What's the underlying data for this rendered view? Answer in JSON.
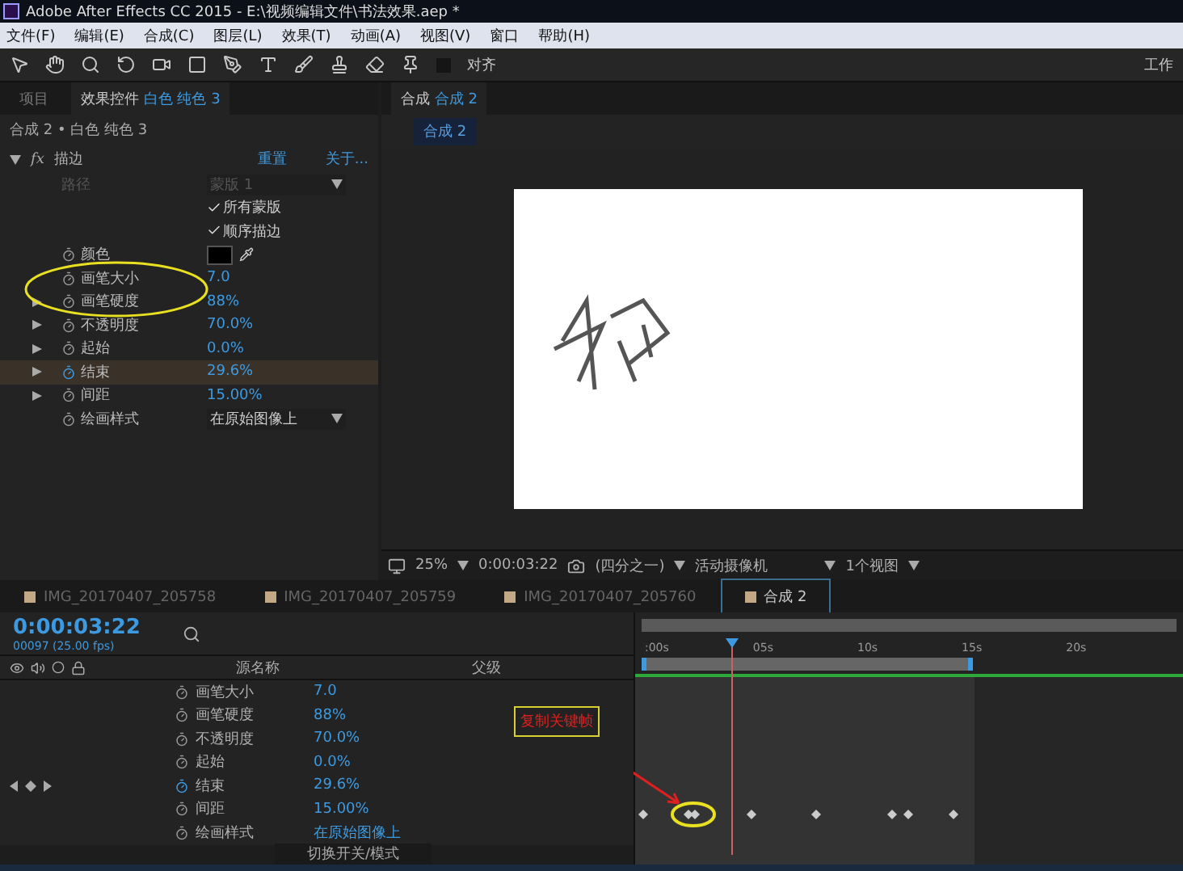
{
  "window": {
    "title": "Adobe After Effects CC 2015 - E:\\视频编辑文件\\书法效果.aep *"
  },
  "menu": [
    "文件(F)",
    "编辑(E)",
    "合成(C)",
    "图层(L)",
    "效果(T)",
    "动画(A)",
    "视图(V)",
    "窗口",
    "帮助(H)"
  ],
  "toolbar": {
    "snap_label": "对齐",
    "snap_checked": false,
    "workspace": "工作"
  },
  "left_panel": {
    "tabs": [
      {
        "label": "项目",
        "selected": false
      },
      {
        "label": "效果控件",
        "subject": "白色 纯色 3",
        "selected": true
      }
    ],
    "breadcrumb": "合成 2 • 白色 纯色 3",
    "effect": {
      "icon_label": "fx",
      "name": "描边",
      "reset": "重置",
      "about": "关于...",
      "props": [
        {
          "kind": "dropdown",
          "label": "路径",
          "value": "蒙版 1",
          "disabled": true
        },
        {
          "kind": "checkbox",
          "label": "所有蒙版",
          "checked": true
        },
        {
          "kind": "checkbox",
          "label": "顺序描边",
          "checked": true
        },
        {
          "kind": "color",
          "label": "颜色",
          "color": "#000000"
        },
        {
          "kind": "value",
          "label": "画笔大小",
          "value": "7.0",
          "expandable": false,
          "highlighted": false,
          "animated": false
        },
        {
          "kind": "value",
          "label": "画笔硬度",
          "value": "88%",
          "expandable": true,
          "highlighted": false,
          "animated": false
        },
        {
          "kind": "value",
          "label": "不透明度",
          "value": "70.0%",
          "expandable": true,
          "highlighted": false,
          "animated": false
        },
        {
          "kind": "value",
          "label": "起始",
          "value": "0.0%",
          "expandable": true,
          "highlighted": false,
          "animated": false
        },
        {
          "kind": "value",
          "label": "结束",
          "value": "29.6%",
          "expandable": true,
          "highlighted": true,
          "animated": true
        },
        {
          "kind": "value",
          "label": "间距",
          "value": "15.00%",
          "expandable": true,
          "highlighted": false,
          "animated": false
        },
        {
          "kind": "dropdown",
          "label": "绘画样式",
          "value": "在原始图像上",
          "disabled": false
        }
      ]
    }
  },
  "comp_panel": {
    "tab": {
      "label": "合成",
      "subject": "合成 2"
    },
    "chip": "合成 2",
    "bottom_bar": {
      "zoom": "25%",
      "timecode": "0:00:03:22",
      "resolution": "(四分之一)",
      "camera": "活动摄像机",
      "views": "1个视图"
    }
  },
  "timeline": {
    "tabs": [
      {
        "label": "IMG_20170407_205758",
        "selected": false
      },
      {
        "label": "IMG_20170407_205759",
        "selected": false
      },
      {
        "label": "IMG_20170407_205760",
        "selected": false
      },
      {
        "label": "合成 2",
        "selected": true
      }
    ],
    "timecode": "0:00:03:22",
    "frame_info": "00097 (25.00 fps)",
    "columns": [
      "源名称",
      "父级"
    ],
    "ruler": [
      ":00s",
      "05s",
      "10s",
      "15s",
      "20s"
    ],
    "rows": [
      {
        "label": "画笔大小",
        "value": "7.0",
        "animated": false
      },
      {
        "label": "画笔硬度",
        "value": "88%",
        "animated": false
      },
      {
        "label": "不透明度",
        "value": "70.0%",
        "animated": false
      },
      {
        "label": "起始",
        "value": "0.0%",
        "animated": false
      },
      {
        "label": "结束",
        "value": "29.6%",
        "animated": true
      },
      {
        "label": "间距",
        "value": "15.00%",
        "animated": false
      },
      {
        "label": "绘画样式",
        "value": "在原始图像上",
        "animated": false
      }
    ],
    "toggle_label": "切换开关/模式",
    "annotation": "复制关键帧"
  }
}
